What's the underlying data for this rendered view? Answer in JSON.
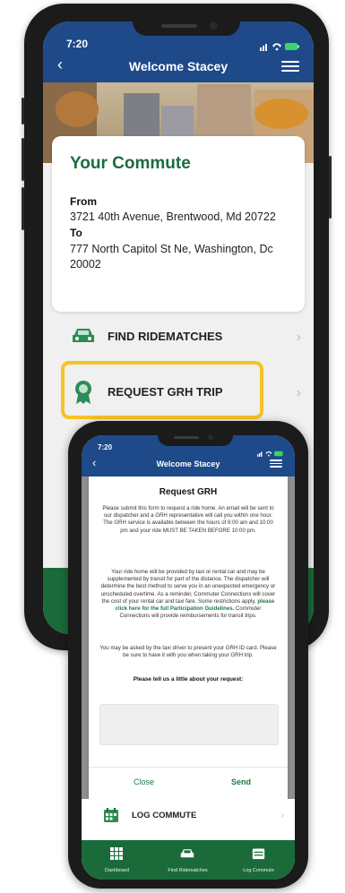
{
  "back_screen": {
    "status_time": "7:20",
    "header_title": "Welcome Stacey",
    "commute_card": {
      "title": "Your Commute",
      "from_label": "From",
      "from_value": "3721 40th Avenue, Brentwood, Md 20722",
      "to_label": "To",
      "to_value": "777 North Capitol St Ne, Washington, Dc 20002"
    },
    "menu": [
      {
        "label": "FIND RIDEMATCHES",
        "icon": "car-icon"
      },
      {
        "label": "REQUEST GRH TRIP",
        "icon": "badge-icon"
      }
    ],
    "highlight_color": "#f7c325"
  },
  "front_screen": {
    "status_time": "7:20",
    "header_title": "Welcome Stacey",
    "modal": {
      "title": "Request GRH",
      "para1": "Please submit this form to request a ride home. An email will be sent to our dispatcher and a GRH representative will call you within one hour. The GRH service is available between the hours of 6:00 am and 10:00 pm and your ride MUST BE TAKEN BEFORE 10:00 pm.",
      "para2_a": "Your ride home will be provided by taxi or rental car and may be supplemented by transit for part of the distance. The dispatcher will determine the best method to serve you in an unexpected emergency or unscheduled overtime. As a reminder, Commuter Connections will cover the cost of your rental car and taxi fare. Some restrictions apply,",
      "para2_link": "please click here for the full Participation Guidelines.",
      "para2_b": "Commuter Connections will provide reimbursements for transit trips.",
      "para3": "You may be asked by the taxi driver to present your GRH ID card. Please be sure to have it with you when taking your GRH trip.",
      "question": "Please tell us a little about your request:",
      "close_label": "Close",
      "send_label": "Send"
    },
    "log_commute_label": "LOG COMMUTE",
    "tabs": [
      {
        "label": "Dashboard",
        "icon": "grid-icon"
      },
      {
        "label": "Find Ridematches",
        "icon": "car-icon"
      },
      {
        "label": "Log Commute",
        "icon": "calendar-icon"
      }
    ],
    "accent_green": "#1f7a45",
    "header_blue": "#1e4a8a"
  }
}
